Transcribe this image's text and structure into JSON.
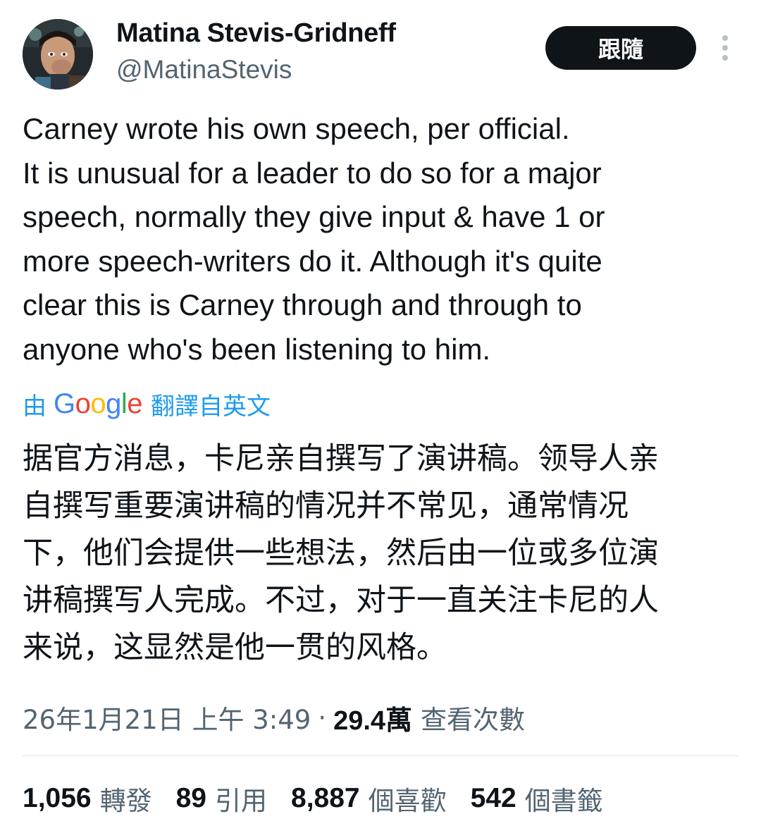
{
  "author": {
    "display_name": "Matina Stevis-Gridneff",
    "handle": "@MatinaStevis"
  },
  "follow_button": {
    "label": "跟隨"
  },
  "tweet": {
    "lines": [
      "Carney wrote his own speech, per official.",
      "It is unusual for a leader to do so for a major",
      "speech, normally they give input & have 1 or",
      "more speech-writers do it. Although it's quite",
      "clear this is Carney through and through to",
      "anyone who's been listening to him."
    ]
  },
  "translation_notice": {
    "prefix": "由",
    "brand_letters": [
      "G",
      "o",
      "o",
      "g",
      "l",
      "e"
    ],
    "brand_colors": [
      "#4285f4",
      "#ea4335",
      "#fbbc05",
      "#4285f4",
      "#34a853",
      "#ea4335"
    ],
    "suffix": "翻譯自英文"
  },
  "translation": {
    "lines": [
      "据官方消息，卡尼亲自撰写了演讲稿。领导人亲",
      "自撰写重要演讲稿的情况并不常见，通常情况",
      "下，他们会提供一些想法，然后由一位或多位演",
      "讲稿撰写人完成。不过，对于一直关注卡尼的人",
      "来说，这显然是他一贯的风格。"
    ]
  },
  "meta": {
    "timestamp": "26年1月21日 上午 3:49",
    "separator": "·",
    "views_count": "29.4萬",
    "views_label": "查看次數"
  },
  "stats": [
    {
      "count": "1,056",
      "label": "轉發"
    },
    {
      "count": "89",
      "label": "引用"
    },
    {
      "count": "8,887",
      "label": "個喜歡"
    },
    {
      "count": "542",
      "label": "個書籤"
    }
  ],
  "colors": {
    "text_primary": "#0f1419",
    "text_secondary": "#536471",
    "link_blue": "#1d9bf0",
    "button_dark": "#0f1419"
  },
  "icons": {
    "more": "more-vertical-icon"
  }
}
